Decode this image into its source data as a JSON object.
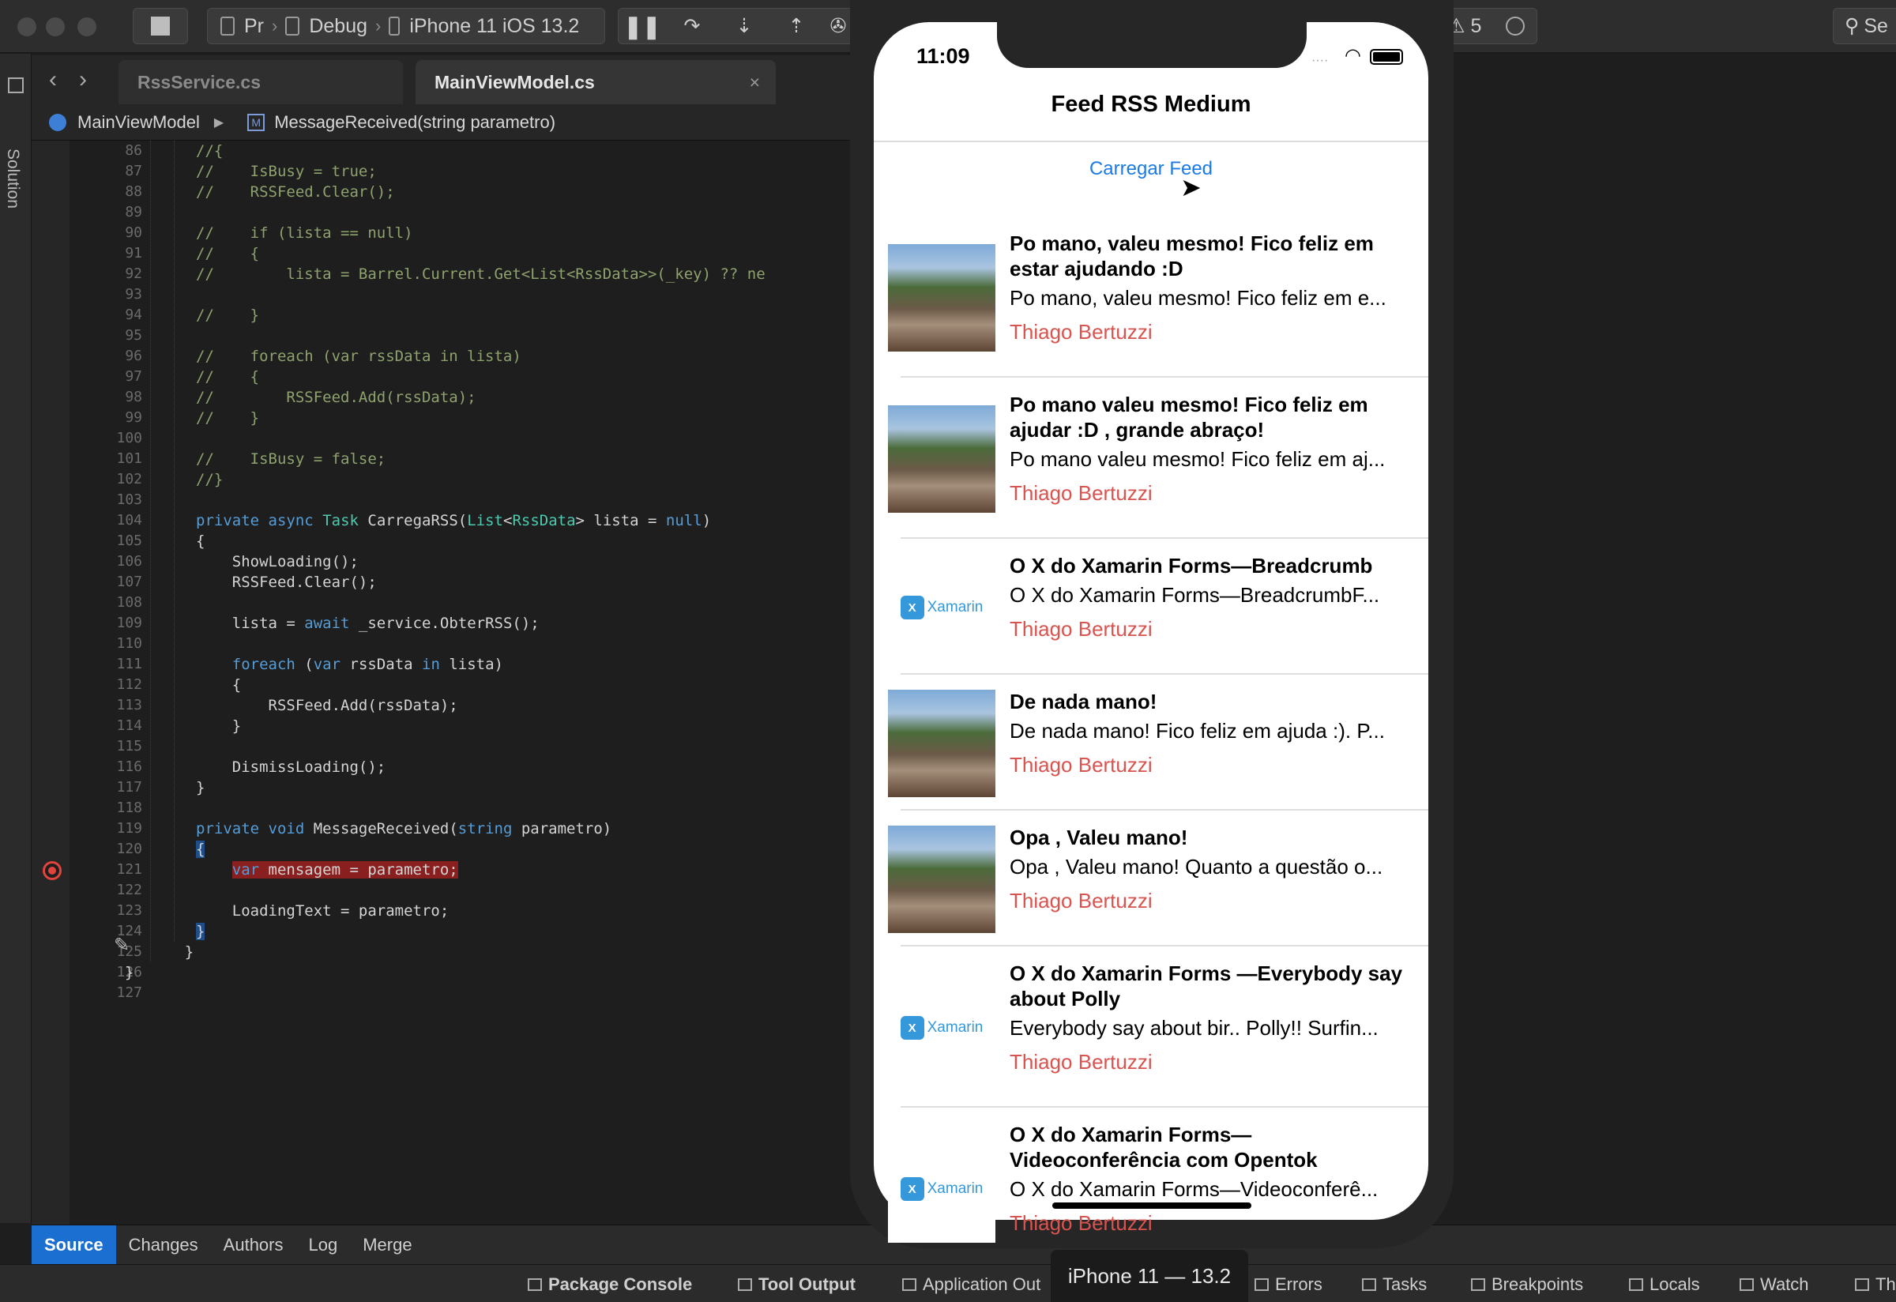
{
  "toolbar": {
    "project_label": "Pr",
    "config_label": "Debug",
    "device_label": "iPhone 11 iOS 13.2",
    "warnings_count": "5",
    "search_label": "Se"
  },
  "sidebar_strip_label": "Solution",
  "tabs": [
    {
      "label": "RssService.cs"
    },
    {
      "label": "MainViewModel.cs"
    }
  ],
  "breadcrumb": {
    "class_label": "MainViewModel",
    "method_label": "MessageReceived(string parametro)"
  },
  "code": {
    "line_numbers": [
      "86",
      "87",
      "88",
      "89",
      "90",
      "91",
      "92",
      "93",
      "94",
      "95",
      "96",
      "97",
      "98",
      "99",
      "100",
      "101",
      "102",
      "103",
      "104",
      "105",
      "106",
      "107",
      "108",
      "109",
      "110",
      "111",
      "112",
      "113",
      "114",
      "115",
      "116",
      "117",
      "118",
      "119",
      "120",
      "121",
      "122",
      "123",
      "124",
      "125",
      "126",
      "127"
    ],
    "lines": [
      "//{",
      "//    IsBusy = true;",
      "//    RSSFeed.Clear();",
      "",
      "//    if (lista == null)",
      "//    {",
      "//        lista = Barrel.Current.Get<List<RssData>>(_key) ?? ne",
      "",
      "//    }",
      "",
      "//    foreach (var rssData in lista)",
      "//    {",
      "//        RSSFeed.Add(rssData);",
      "//    }",
      "",
      "//    IsBusy = false;",
      "//}",
      "",
      "private async Task CarregaRSS(List<RssData> lista = null)",
      "{",
      "    ShowLoading();",
      "    RSSFeed.Clear();",
      "",
      "    lista = await _service.ObterRSS();",
      "",
      "    foreach (var rssData in lista)",
      "    {",
      "        RSSFeed.Add(rssData);",
      "    }",
      "",
      "    DismissLoading();",
      "}",
      "",
      "private void MessageReceived(string parametro)",
      "{",
      "    var mensagem = parametro;",
      "",
      "    LoadingText = parametro;",
      "}",
      "    }",
      "}",
      ""
    ]
  },
  "version_tabs": [
    "Source",
    "Changes",
    "Authors",
    "Log",
    "Merge"
  ],
  "statusbar": {
    "items": [
      "Package Console",
      "Tool Output",
      "Application Out",
      "Errors",
      "Tasks",
      "Breakpoints",
      "Locals",
      "Watch",
      "Th"
    ],
    "simulator_label": "iPhone 11 — 13.2"
  },
  "app": {
    "time": "11:09",
    "title": "Feed RSS Medium",
    "load_button": "Carregar Feed",
    "items": [
      {
        "title": "Po mano, valeu mesmo! Fico feliz em estar ajudando :D",
        "desc": "Po mano, valeu mesmo! Fico feliz em e...",
        "author": "Thiago Bertuzzi",
        "image": "landscape"
      },
      {
        "title": "Po mano valeu mesmo! Fico feliz em ajudar :D , grande abraço!",
        "desc": "Po mano valeu mesmo! Fico feliz em aj...",
        "author": "Thiago Bertuzzi",
        "image": "landscape"
      },
      {
        "title": "O X do Xamarin Forms—Breadcrumb",
        "desc": "O X do Xamarin Forms—BreadcrumbF...",
        "author": "Thiago Bertuzzi",
        "image": "xamarin"
      },
      {
        "title": "De nada mano!",
        "desc": "De nada mano! Fico feliz em ajuda :). P...",
        "author": "Thiago Bertuzzi",
        "image": "landscape"
      },
      {
        "title": "Opa , Valeu mano!",
        "desc": "Opa , Valeu mano! Quanto a questão o...",
        "author": "Thiago Bertuzzi",
        "image": "landscape"
      },
      {
        "title": "O X do Xamarin Forms —Everybody say about Polly",
        "desc": "Everybody say about bir.. Polly!! Surfin...",
        "author": "Thiago Bertuzzi",
        "image": "xamarin"
      },
      {
        "title": "O X do Xamarin Forms— Videoconferência com Opentok",
        "desc": "O X do Xamarin Forms—Videoconferê...",
        "author": "Thiago Bertuzzi",
        "image": "xamarin"
      }
    ],
    "xamarin_logo_text": "Xamarin"
  }
}
